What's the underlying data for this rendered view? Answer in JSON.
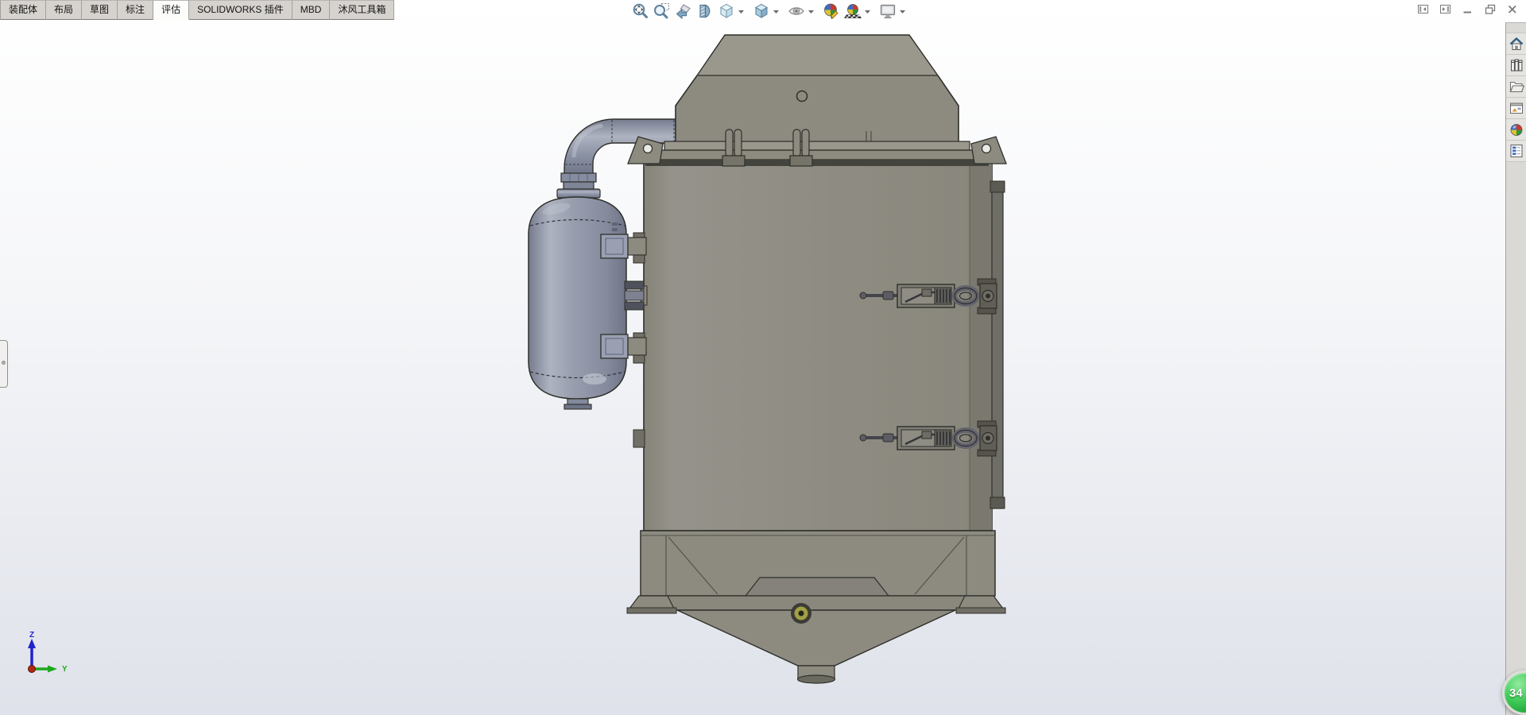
{
  "app": {
    "name": "SOLIDWORKS"
  },
  "command_manager": {
    "tabs": [
      {
        "label": "装配体",
        "active": false
      },
      {
        "label": "布局",
        "active": false
      },
      {
        "label": "草图",
        "active": false
      },
      {
        "label": "标注",
        "active": false
      },
      {
        "label": "评估",
        "active": true
      },
      {
        "label": "SOLIDWORKS 插件",
        "active": false
      },
      {
        "label": "MBD",
        "active": false
      },
      {
        "label": "沐风工具箱",
        "active": false
      }
    ]
  },
  "heads_up_toolbar": {
    "items": [
      {
        "icon": "zoom-to-fit-icon",
        "dropdown": false
      },
      {
        "icon": "zoom-to-area-icon",
        "dropdown": false
      },
      {
        "icon": "previous-view-icon",
        "dropdown": false
      },
      {
        "icon": "section-view-icon",
        "dropdown": false
      },
      {
        "icon": "view-orientation-icon",
        "dropdown": true
      },
      {
        "icon": "display-style-icon",
        "dropdown": true
      },
      {
        "icon": "hide-show-items-icon",
        "dropdown": true
      },
      {
        "icon": "edit-appearance-icon",
        "dropdown": false
      },
      {
        "icon": "apply-scene-icon",
        "dropdown": true
      },
      {
        "icon": "view-settings-icon",
        "dropdown": true
      }
    ]
  },
  "window_controls": [
    "collapse-pane-left",
    "collapse-pane-right",
    "minimize",
    "restore",
    "close"
  ],
  "task_pane": {
    "items": [
      "home-icon",
      "design-library-icon",
      "file-explorer-icon",
      "view-palette-icon",
      "appearances-scenes-icon",
      "custom-properties-icon"
    ]
  },
  "viewport": {
    "model": "dust-collector-assembly",
    "model_parts": [
      "exhaust-hood",
      "lid-with-clamps",
      "pipe-elbow",
      "buffer-tank",
      "main-cabinet",
      "access-door-latches",
      "door-edge-frame",
      "support-base",
      "discharge-hopper",
      "outlet-pipe"
    ],
    "orientation_triad": {
      "axis_labels": {
        "z": "Z",
        "y": "Y"
      }
    }
  },
  "overlay_badge": {
    "text": "34"
  },
  "colors": {
    "metal": "#8d8b80",
    "metal-light": "#9a988d",
    "metal-dark": "#727066",
    "outline": "#2e2f2a",
    "steel": "#939aac",
    "steel-light": "#b2b7c4",
    "steel-dark": "#6b7183",
    "vp-top": "#ffffff",
    "vp-bottom": "#dfe2ea",
    "tabbar": "#d6d3cf",
    "tab-active": "#fcfcfb",
    "taskpane": "#dbd9d6",
    "badge": "#2cb546",
    "triad-z": "#2222cc",
    "triad-y": "#1fa81f",
    "triad-x": "#b02812"
  }
}
